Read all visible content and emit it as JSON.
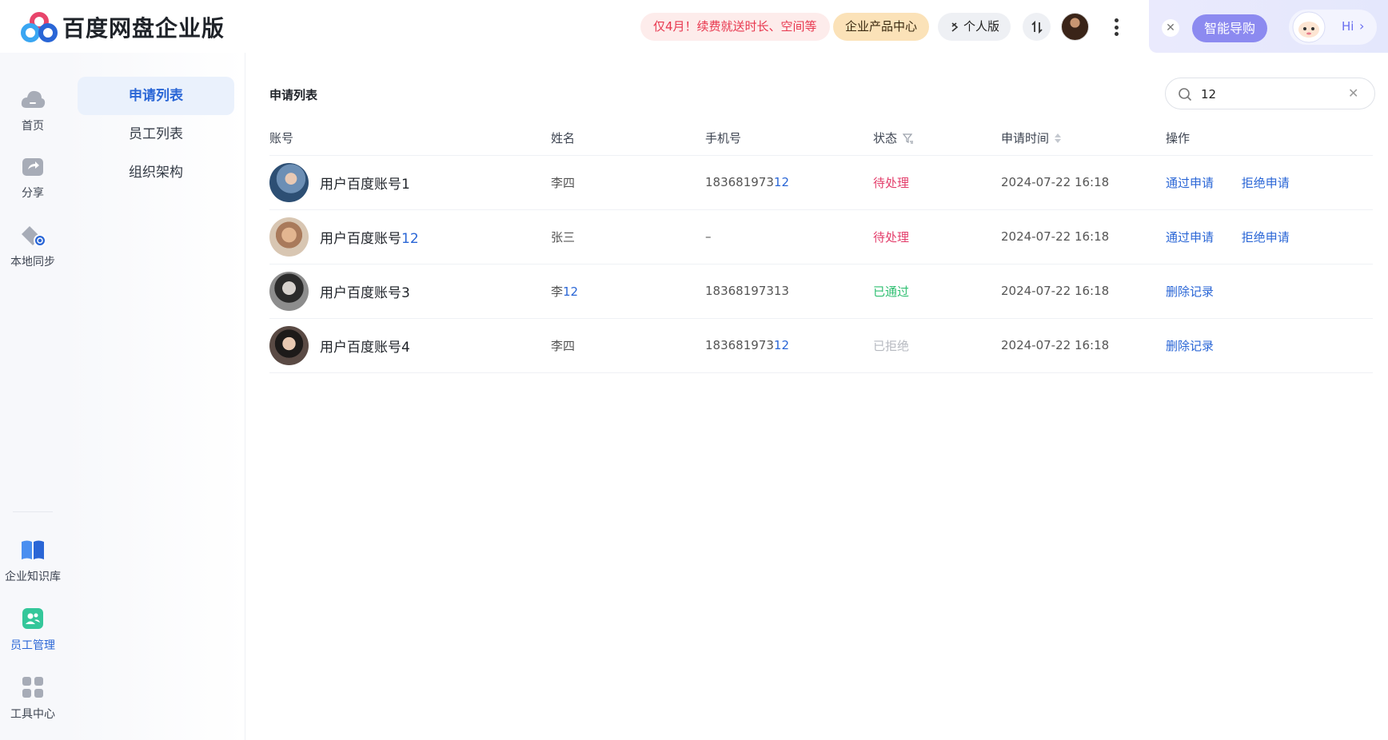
{
  "header": {
    "title": "百度网盘企业版",
    "promo": "仅4月！续费就送时长、空间等",
    "product_center": "企业产品中心",
    "personal": "个人版",
    "guide": "智能导购",
    "hi": "Hi"
  },
  "rail": {
    "items": [
      {
        "label": "首页",
        "icon": "cloud-icon"
      },
      {
        "label": "分享",
        "icon": "share-icon"
      },
      {
        "label": "本地同步",
        "icon": "sync-icon"
      },
      {
        "label": "企业知识库",
        "icon": "book-icon"
      },
      {
        "label": "员工管理",
        "icon": "staff-icon",
        "active": true
      },
      {
        "label": "工具中心",
        "icon": "grid-icon"
      }
    ]
  },
  "subnav": {
    "items": [
      {
        "label": "申请列表",
        "active": true
      },
      {
        "label": "员工列表"
      },
      {
        "label": "组织架构"
      }
    ]
  },
  "main": {
    "title": "申请列表",
    "search": {
      "value": "12"
    },
    "columns": [
      "账号",
      "姓名",
      "手机号",
      "状态",
      "申请时间",
      "操作"
    ],
    "rows": [
      {
        "account_pre": "用户百度账号1",
        "account_hl": "",
        "name_pre": "李四",
        "name_hl": "",
        "phone_pre": "183681973",
        "phone_hl": "12",
        "status": "待处理",
        "time": "2024-07-22 16:18",
        "op1": "通过申请",
        "op2": "拒绝申请"
      },
      {
        "account_pre": "用户百度账号",
        "account_hl": "12",
        "name_pre": "张三",
        "name_hl": "",
        "phone_pre": "–",
        "phone_hl": "",
        "status": "待处理",
        "time": "2024-07-22 16:18",
        "op1": "通过申请",
        "op2": "拒绝申请"
      },
      {
        "account_pre": "用户百度账号3",
        "account_hl": "",
        "name_pre": "李",
        "name_hl": "12",
        "phone_pre": "18368197313",
        "phone_hl": "",
        "status": "已通过",
        "time": "2024-07-22 16:18",
        "op1": "删除记录",
        "op2": ""
      },
      {
        "account_pre": "用户百度账号4",
        "account_hl": "",
        "name_pre": "李四",
        "name_hl": "",
        "phone_pre": "183681973",
        "phone_hl": "12",
        "status": "已拒绝",
        "time": "2024-07-22 16:18",
        "op1": "删除记录",
        "op2": ""
      }
    ]
  },
  "colors": {
    "accent": "#2a66d6",
    "pending": "#e33e6b",
    "passed": "#2fbf71",
    "rejected": "#b6b9c0"
  }
}
